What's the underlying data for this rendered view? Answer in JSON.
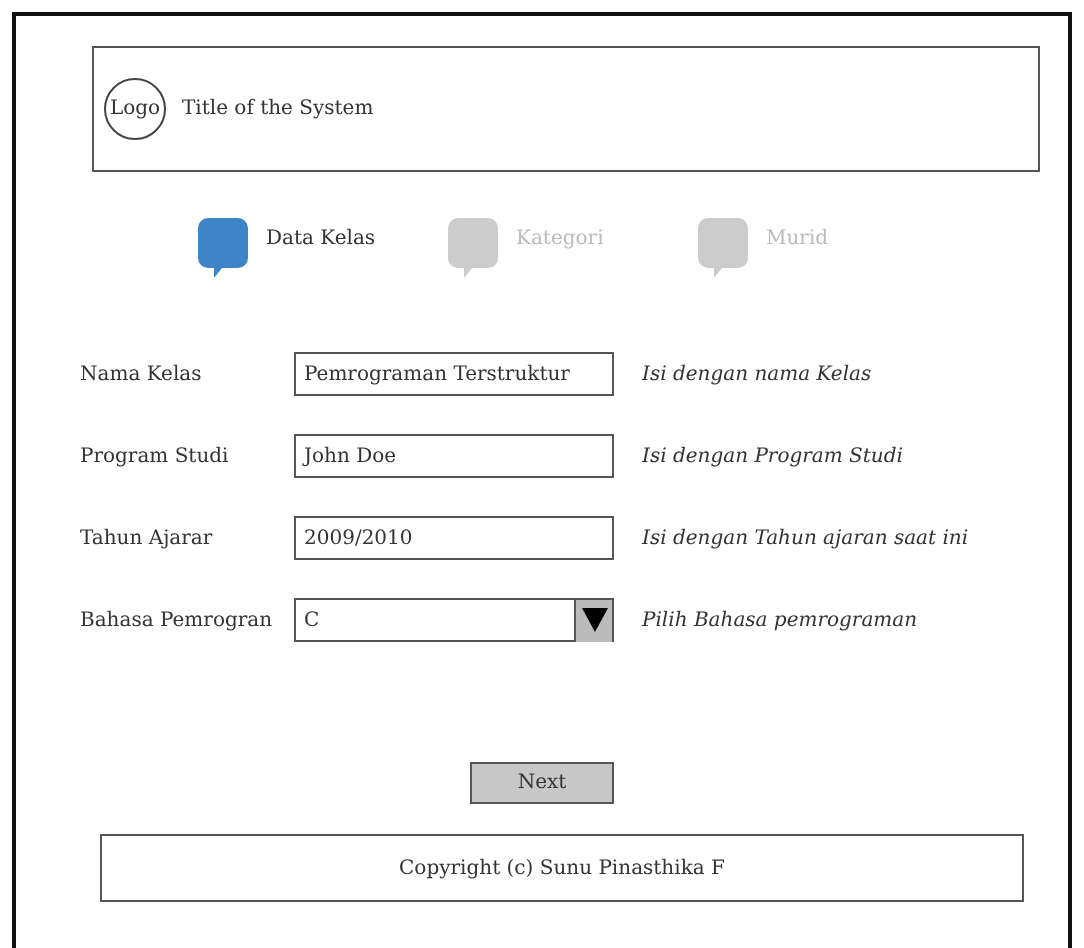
{
  "header": {
    "logo": "Logo",
    "title": "Title of the System"
  },
  "steps": [
    {
      "label": "Data Kelas",
      "selected": true
    },
    {
      "label": "Kategori",
      "selected": false
    },
    {
      "label": "Murid",
      "selected": false
    }
  ],
  "fields": [
    {
      "kind": "text",
      "label": "Nama Kelas",
      "value": "Pemrograman Terstruktur",
      "hint": "Isi dengan nama Kelas"
    },
    {
      "kind": "text",
      "label": "Program Studi",
      "value": "John Doe",
      "hint": "Isi dengan Program Studi"
    },
    {
      "kind": "text",
      "label": "Tahun Ajarar",
      "value": "2009/2010",
      "hint": "Isi dengan Tahun ajaran saat ini"
    },
    {
      "kind": "select",
      "label": "Bahasa Pemrogran",
      "value": "C",
      "hint": "Pilih Bahasa pemrograman"
    }
  ],
  "next_button": "Next",
  "footer": "Copyright (c)  Sunu Pinasthika F"
}
